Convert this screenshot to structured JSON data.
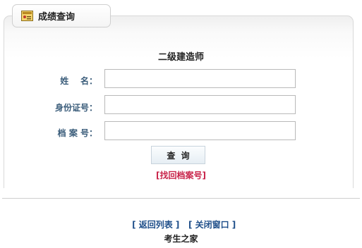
{
  "tab": {
    "title": "成绩查询",
    "icon": "grade-certificate-icon"
  },
  "form": {
    "heading": "二级建造师",
    "fields": [
      {
        "label": "姓    名：",
        "value": "",
        "placeholder": ""
      },
      {
        "label": "身份证号：",
        "value": "",
        "placeholder": ""
      },
      {
        "label": "档 案 号：",
        "value": "",
        "placeholder": ""
      }
    ],
    "query_label": "查  询",
    "retrieve_link": "[找回档案号]"
  },
  "links": {
    "back": "[ 返回列表 ]",
    "close": "[ 关闭窗口 ]"
  },
  "footer": {
    "text": "考生之家"
  },
  "colors": {
    "label": "#3a5c7a",
    "retrieve": "#c8244a",
    "link": "#1f4f8a"
  }
}
